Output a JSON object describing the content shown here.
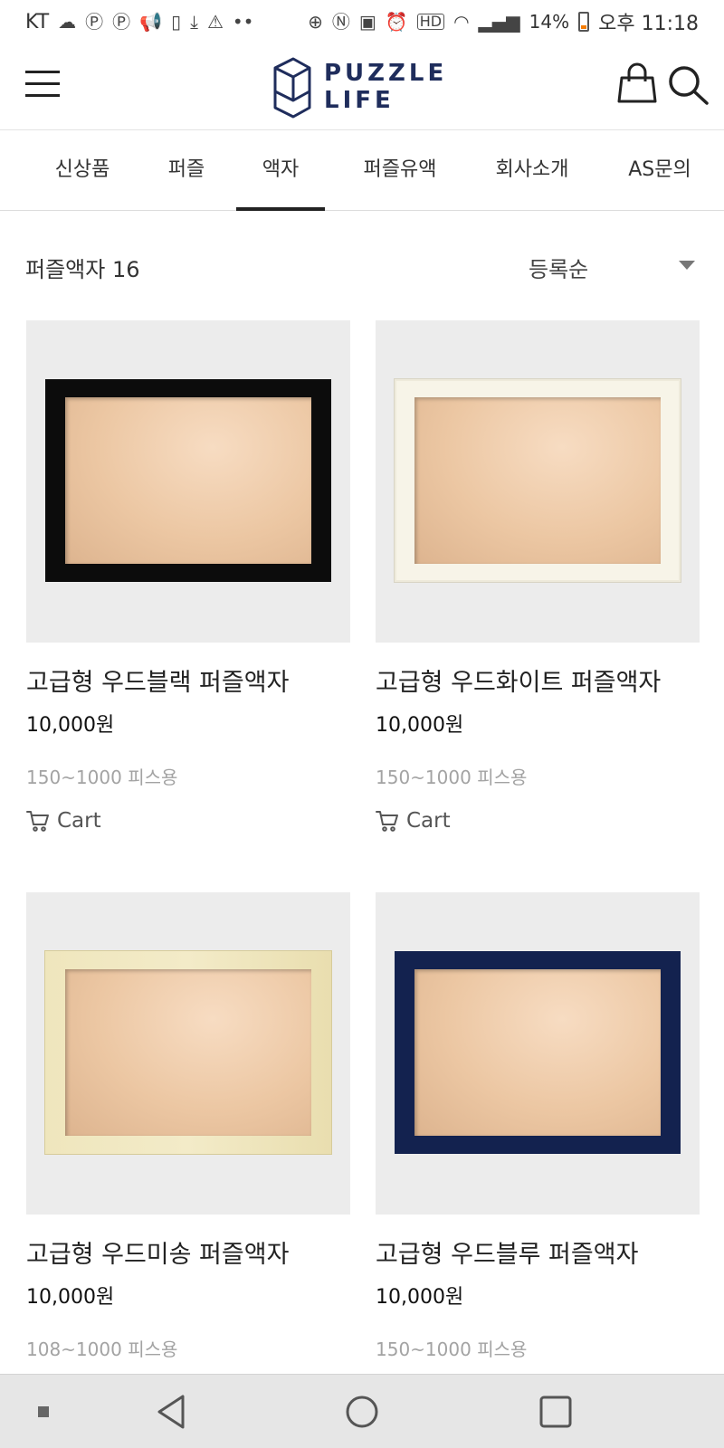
{
  "status_bar": {
    "carrier": "KT",
    "battery": "14%",
    "time": "오후 11:18",
    "hd_label": "HD"
  },
  "header": {
    "logo_line1": "PUZZLE",
    "logo_line2": "LIFE"
  },
  "tabs": [
    {
      "label": "신상품"
    },
    {
      "label": "퍼즐"
    },
    {
      "label": "액자",
      "active": true
    },
    {
      "label": "퍼즐유액"
    },
    {
      "label": "회사소개"
    },
    {
      "label": "AS문의"
    }
  ],
  "listing": {
    "count_label": "퍼즐액자 16",
    "sort_selected": "등록순"
  },
  "products": [
    {
      "name": "고급형 우드블랙 퍼즐액자",
      "price": "10,000원",
      "pieces": "150~1000 피스용",
      "cart_label": "Cart",
      "frame_color": "#0c0c0c"
    },
    {
      "name": "고급형 우드화이트 퍼즐액자",
      "price": "10,000원",
      "pieces": "150~1000 피스용",
      "cart_label": "Cart",
      "frame_color": "#f7f4e8"
    },
    {
      "name": "고급형 우드미송 퍼즐액자",
      "price": "10,000원",
      "pieces": "108~1000 피스용",
      "frame_color": "#efe6bd"
    },
    {
      "name": "고급형 우드블루 퍼즐액자",
      "price": "10,000원",
      "pieces": "150~1000 피스용",
      "frame_color": "#13224f"
    }
  ],
  "colors": {
    "brand": "#1f2d5c",
    "accent_underline": "#222222"
  }
}
